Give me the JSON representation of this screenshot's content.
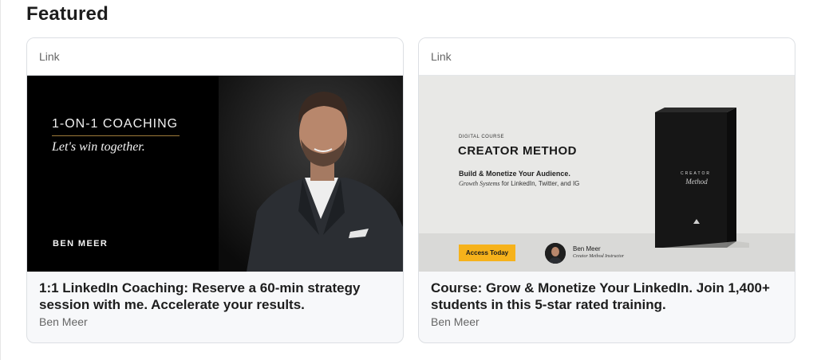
{
  "section": {
    "title": "Featured"
  },
  "cards": [
    {
      "type_label": "Link",
      "title": "1:1 LinkedIn Coaching: Reserve a 60-min strategy session with me. Accelerate your results.",
      "author": "Ben Meer",
      "media": {
        "kicker": "1-ON-1 COACHING",
        "tagline": "Let's win together.",
        "name": "BEN MEER",
        "accent_color": "#9f7b3a"
      }
    },
    {
      "type_label": "Link",
      "title": "Course: Grow & Monetize Your LinkedIn. Join 1,400+ students in this 5-star rated training.",
      "author": "Ben Meer",
      "media": {
        "kicker": "DIGITAL COURSE",
        "title": "CREATOR METHOD",
        "subtitle": "Build & Monetize Your Audience.",
        "subtitle2_italic": "Growth Systems",
        "subtitle2_rest": "for LinkedIn, Twitter, and IG",
        "cta": "Access Today",
        "instructor_name": "Ben Meer",
        "instructor_role": "Creator Method Instructor",
        "box_brand": "CREATOR",
        "box_script": "Method",
        "cta_color": "#f6b21b"
      }
    }
  ]
}
